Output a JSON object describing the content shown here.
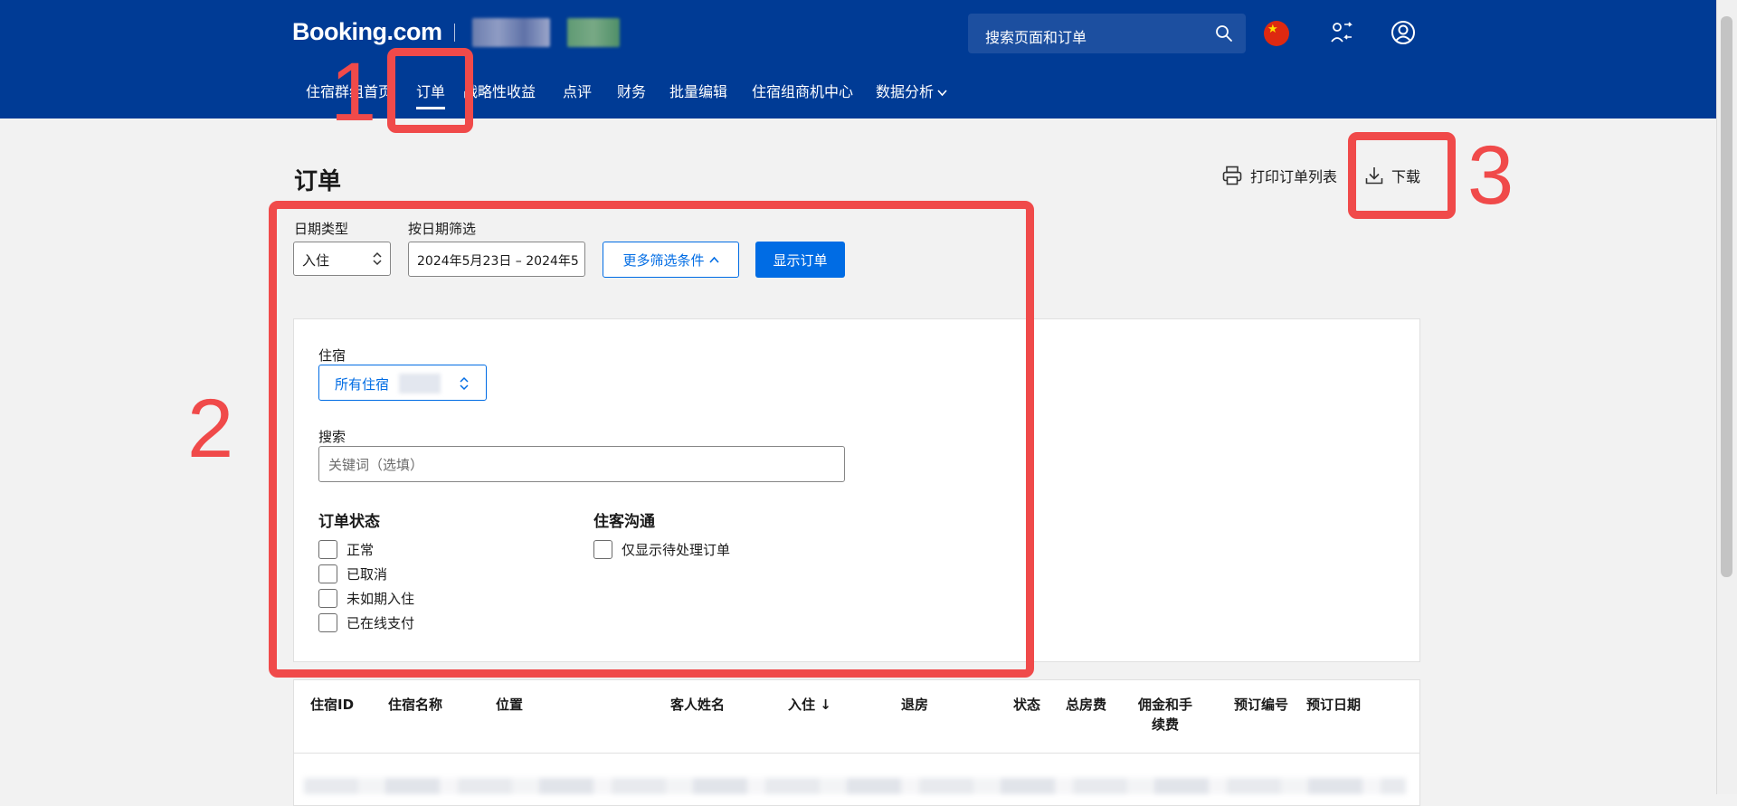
{
  "header": {
    "logo": "Booking.com",
    "search_placeholder": "搜索页面和订单",
    "flag_glyph": "★",
    "nav": [
      {
        "label": "住宿群组首页"
      },
      {
        "label": "订单",
        "active": true
      },
      {
        "label": "战略性收益"
      },
      {
        "label": "点评"
      },
      {
        "label": "财务"
      },
      {
        "label": "批量编辑"
      },
      {
        "label": "住宿组商机中心"
      },
      {
        "label": "数据分析"
      }
    ]
  },
  "page": {
    "title": "订单",
    "print_label": "打印订单列表",
    "download_label": "下载"
  },
  "filters": {
    "date_type_label": "日期类型",
    "date_type_value": "入住",
    "date_filter_label": "按日期筛选",
    "date_range_value": "2024年5月23日 – 2024年5",
    "more_filters_label": "更多筛选条件",
    "show_orders_label": "显示订单",
    "property_label": "住宿",
    "property_value": "所有住宿",
    "search_label": "搜索",
    "search_placeholder": "关键词（选填）",
    "status_title": "订单状态",
    "status_options": [
      "正常",
      "已取消",
      "未如期入住",
      "已在线支付"
    ],
    "guest_comm_title": "住客沟通",
    "guest_comm_option": "仅显示待处理订单"
  },
  "table": {
    "columns": [
      "住宿ID",
      "住宿名称",
      "位置",
      "客人姓名",
      "入住 ↓",
      "退房",
      "状态",
      "总房费",
      "佣金和手续费",
      "预订编号",
      "预订日期"
    ]
  },
  "annotations": {
    "one": "1",
    "two": "2",
    "three": "3",
    "color": "#f04a4a"
  },
  "colors": {
    "header_bg": "#003b95",
    "accent": "#006ce4"
  }
}
